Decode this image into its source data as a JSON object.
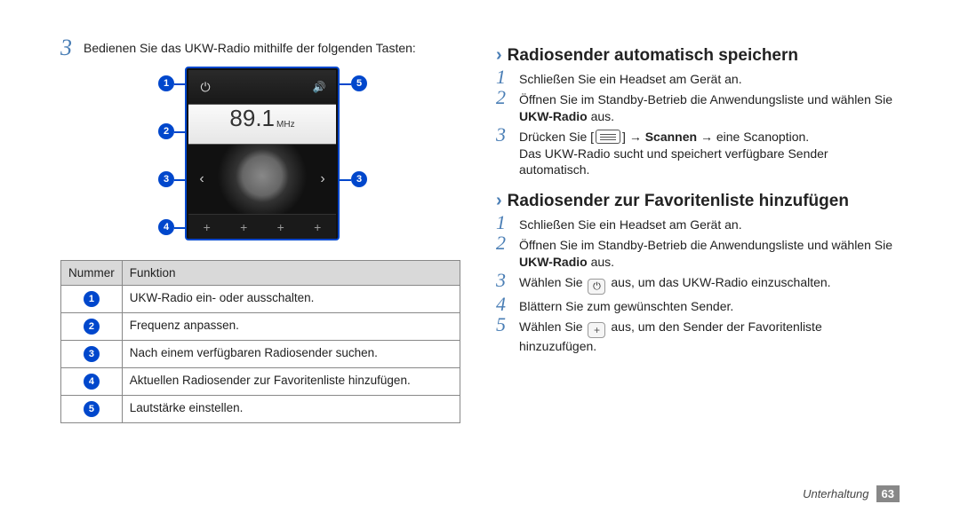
{
  "left": {
    "step3": {
      "num": "3",
      "text": "Bedienen Sie das UKW-Radio mithilfe der folgenden Tasten:"
    },
    "radio_ui": {
      "frequency": "89.1",
      "unit": "MHz"
    },
    "table": {
      "head_num": "Nummer",
      "head_func": "Funktion",
      "rows": [
        {
          "n": "1",
          "f": "UKW-Radio ein- oder ausschalten."
        },
        {
          "n": "2",
          "f": "Frequenz anpassen."
        },
        {
          "n": "3",
          "f": "Nach einem verfügbaren Radiosender suchen."
        },
        {
          "n": "4",
          "f": "Aktuellen Radiosender zur Favoritenliste hinzufügen."
        },
        {
          "n": "5",
          "f": "Lautstärke einstellen."
        }
      ]
    }
  },
  "right": {
    "section_auto": {
      "title": "Radiosender automatisch speichern",
      "steps": {
        "s1_num": "1",
        "s1_text": "Schließen Sie ein Headset am Gerät an.",
        "s2_num": "2",
        "s2_text_a": "Öffnen Sie im Standby-Betrieb die Anwendungsliste und wählen Sie ",
        "s2_bold": "UKW-Radio",
        "s2_text_b": " aus.",
        "s3_num": "3",
        "s3_a": "Drücken Sie [",
        "s3_b": "] → ",
        "s3_bold": "Scannen",
        "s3_c": " → eine Scanoption.",
        "s3_note": "Das UKW-Radio sucht und speichert verfügbare Sender automatisch."
      }
    },
    "section_fav": {
      "title": "Radiosender zur Favoritenliste hinzufügen",
      "steps": {
        "s1_num": "1",
        "s1_text": "Schließen Sie ein Headset am Gerät an.",
        "s2_num": "2",
        "s2_text_a": "Öffnen Sie im Standby-Betrieb die Anwendungsliste und wählen Sie ",
        "s2_bold": "UKW-Radio",
        "s2_text_b": " aus.",
        "s3_num": "3",
        "s3_a": "Wählen Sie ",
        "s3_b": " aus, um das UKW-Radio einzuschalten.",
        "s4_num": "4",
        "s4_text": "Blättern Sie zum gewünschten Sender.",
        "s5_num": "5",
        "s5_a": "Wählen Sie ",
        "s5_b": " aus, um den Sender der Favoritenliste hinzuzufügen."
      }
    }
  },
  "footer": {
    "section": "Unterhaltung",
    "page": "63"
  },
  "callouts": {
    "c1": "1",
    "c2": "2",
    "c3": "3",
    "c4": "4",
    "c5": "5"
  }
}
